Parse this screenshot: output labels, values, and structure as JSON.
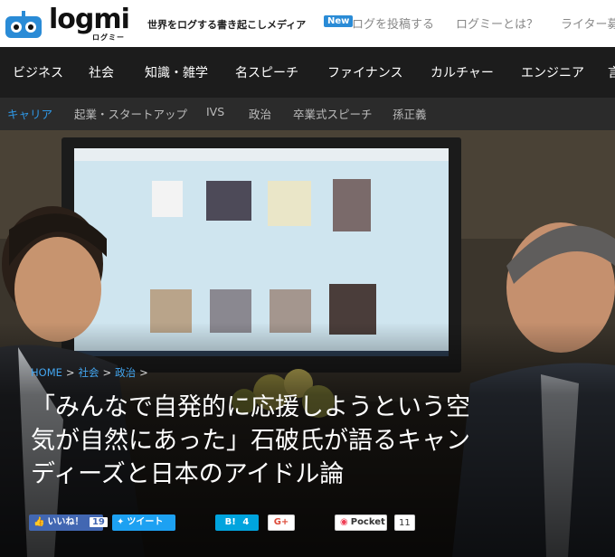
{
  "header": {
    "logo_text": "logmi",
    "logo_sub": "ログミー",
    "tagline": "世界をログする書き起こしメディア",
    "new_badge": "New",
    "links": [
      "ログを投稿する",
      "ログミーとは？",
      "ライター募"
    ]
  },
  "main_nav": [
    "ビジネス",
    "社会",
    "知識・雑学",
    "名スピーチ",
    "ファイナンス",
    "カルチャー",
    "エンジニア",
    "言"
  ],
  "sub_nav": [
    "キャリア",
    "起業・スタートアップ",
    "IVS",
    "政治",
    "卒業式スピーチ",
    "孫正義"
  ],
  "breadcrumb": [
    "HOME",
    "社会",
    "政治"
  ],
  "breadcrumb_sep": ">",
  "article": {
    "title_lines": [
      "「みんなで自発的に応援しようという空",
      "気が自然にあった」石破氏が語るキャン",
      "ディーズと日本のアイドル論"
    ]
  },
  "share": {
    "like_label": "いいね！",
    "like_count": "19",
    "tweet_label": "ツイート",
    "hatena_label": "B!",
    "hatena_count": "4",
    "gplus_label": "G+",
    "pocket_label": "Pocket",
    "pocket_count": "11"
  },
  "colors": {
    "accent": "#2f98e6",
    "facebook": "#4267b2",
    "twitter": "#1da1f2",
    "hatena": "#00a4de",
    "gplus": "#dd4b39",
    "pocket": "#ef4056"
  }
}
